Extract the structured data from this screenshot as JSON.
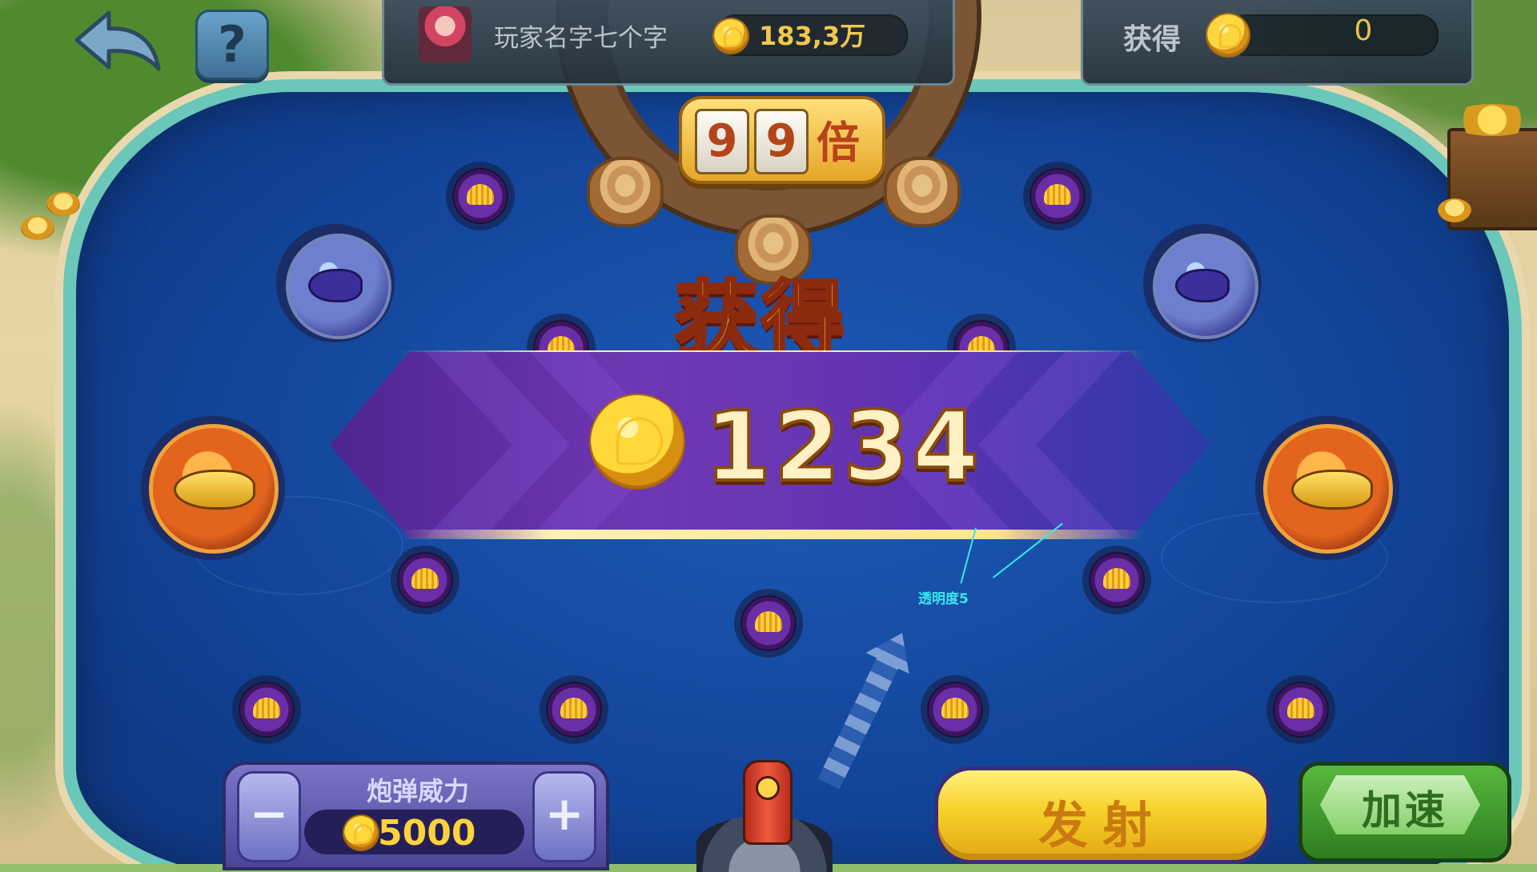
{
  "player": {
    "name": "玩家名字七个字",
    "balance": "183,3万"
  },
  "earned": {
    "label": "获得",
    "value": "0"
  },
  "multiplier": {
    "digits": [
      "9",
      "9"
    ],
    "unit": "倍"
  },
  "help_label": "?",
  "reward": {
    "title": "获得",
    "amount": "1234"
  },
  "annotation": "透明度5",
  "cannon_power": {
    "label": "炮弹威力",
    "value": "5000",
    "minus": "−",
    "plus": "+"
  },
  "buttons": {
    "fire": "发射",
    "speed": "加速"
  },
  "colors": {
    "banner_purple": "#5a2aaf",
    "pond_blue": "#13459a",
    "fire_yellow": "#f6d12a",
    "speed_green": "#2f7d22",
    "annotation_cyan": "#37e6ef"
  },
  "icons": {
    "back": "back-arrow-icon",
    "coin": "gold-coin-icon",
    "shell": "shell-icon"
  }
}
